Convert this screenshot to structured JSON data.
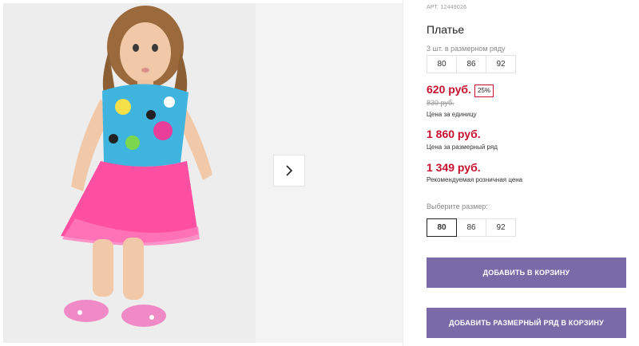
{
  "product": {
    "article": "АРТ. 12449026",
    "title": "Платье"
  },
  "pack": {
    "label": "3 шт. в размерном ряду",
    "sizes": [
      "80",
      "86",
      "92"
    ]
  },
  "pricing": {
    "unit_price": "620 руб.",
    "discount": "25%",
    "old_price": "830 руб.",
    "unit_note": "Цена за единицу",
    "pack_price": "1 860 руб.",
    "pack_note": "Цена за размерный ряд",
    "retail_price": "1 349 руб.",
    "retail_note": "Рекомендуемая розничная цена"
  },
  "size_picker": {
    "label": "Выберите размер:",
    "sizes": [
      "80",
      "86",
      "92"
    ],
    "selected": "80"
  },
  "buttons": {
    "add_to_cart": "ДОБАВИТЬ В КОРЗИНУ",
    "add_pack_to_cart": "ДОБАВИТЬ РАЗМЕРНЫЙ РЯД В КОРЗИНУ"
  },
  "colors": {
    "price_red": "#c8102e",
    "button_purple": "#7b6aa8"
  },
  "icons": {
    "next": "chevron-right-icon"
  }
}
